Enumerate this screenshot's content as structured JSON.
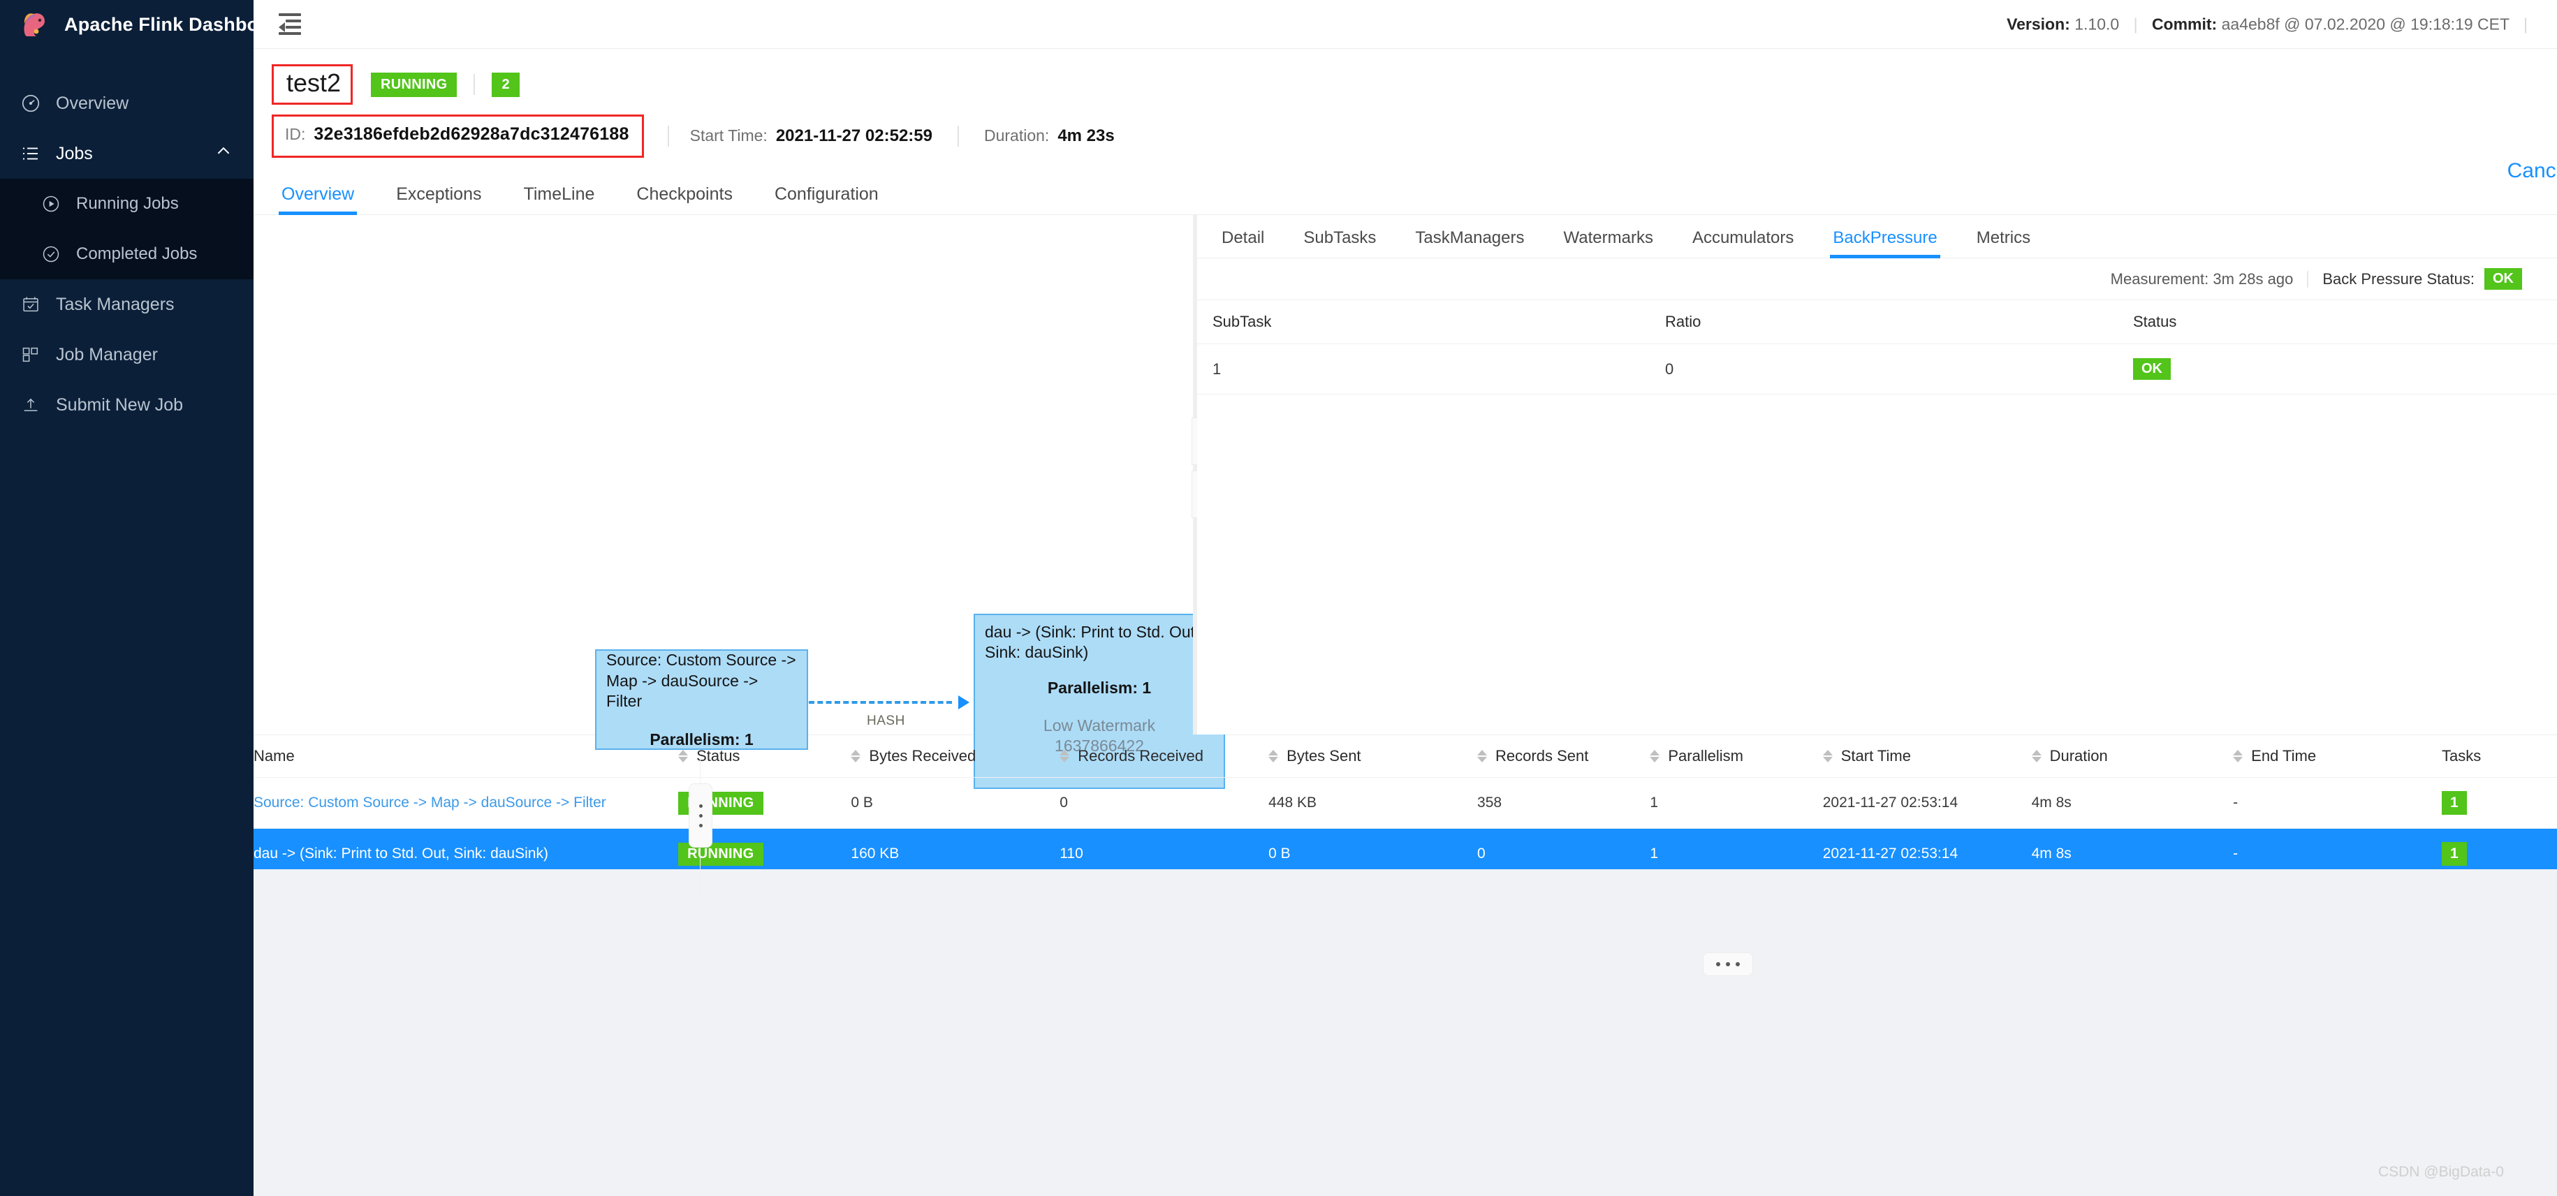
{
  "brand": {
    "title": "Apache Flink Dashboard",
    "logo_icon": "flink-squirrel-logo"
  },
  "sidebar": {
    "items": [
      {
        "label": "Overview",
        "icon": "dashboard-icon",
        "type": "item"
      },
      {
        "label": "Jobs",
        "icon": "list-icon",
        "type": "group",
        "expanded": true,
        "caret": "chevron-up-icon"
      },
      {
        "label": "Running Jobs",
        "icon": "play-circle-icon",
        "type": "sub"
      },
      {
        "label": "Completed Jobs",
        "icon": "check-circle-icon",
        "type": "sub"
      },
      {
        "label": "Task Managers",
        "icon": "calendar-check-icon",
        "type": "item"
      },
      {
        "label": "Job Manager",
        "icon": "cluster-icon",
        "type": "item"
      },
      {
        "label": "Submit New Job",
        "icon": "upload-icon",
        "type": "item"
      }
    ]
  },
  "topbar": {
    "menu_fold_icon": "menu-fold-icon",
    "version_label": "Version:",
    "version_value": "1.10.0",
    "commit_label": "Commit:",
    "commit_value": "aa4eb8f @ 07.02.2020 @ 19:18:19 CET"
  },
  "job": {
    "name": "test2",
    "status": "RUNNING",
    "attempt": "2",
    "id_label": "ID:",
    "id_value": "32e3186efdeb2d62928a7dc312476188",
    "start_time_label": "Start Time:",
    "start_time_value": "2021-11-27 02:52:59",
    "duration_label": "Duration:",
    "duration_value": "4m 23s",
    "cancel_label": "Cancel",
    "tabs": [
      {
        "label": "Overview",
        "active": true
      },
      {
        "label": "Exceptions",
        "active": false
      },
      {
        "label": "TimeLine",
        "active": false
      },
      {
        "label": "Checkpoints",
        "active": false
      },
      {
        "label": "Configuration",
        "active": false
      }
    ]
  },
  "graph": {
    "nodes": [
      {
        "title": "Source: Custom Source -> Map -> dauSource -> Filter",
        "parallelism_label": "Parallelism: 1"
      },
      {
        "title": "dau -> (Sink: Print to Std. Out, Sink: dauSink)",
        "parallelism_label": "Parallelism: 1",
        "watermark_label": "Low Watermark",
        "watermark_value": "1637866422"
      }
    ],
    "edge_label": "HASH",
    "expand_right_icon": "chevron-right-icon",
    "collapse_left_icon": "chevron-left-icon"
  },
  "detail": {
    "tabs": [
      {
        "label": "Detail",
        "active": false
      },
      {
        "label": "SubTasks",
        "active": false
      },
      {
        "label": "TaskManagers",
        "active": false
      },
      {
        "label": "Watermarks",
        "active": false
      },
      {
        "label": "Accumulators",
        "active": false
      },
      {
        "label": "BackPressure",
        "active": true
      },
      {
        "label": "Metrics",
        "active": false
      }
    ],
    "measurement": "Measurement: 3m 28s ago",
    "bp_status_label": "Back Pressure Status:",
    "bp_status_value": "OK",
    "table": {
      "columns": [
        "SubTask",
        "Ratio",
        "Status"
      ],
      "rows": [
        {
          "subtask": "1",
          "ratio": "0",
          "status": "OK"
        }
      ]
    }
  },
  "vertices_table": {
    "columns": [
      {
        "label": "Name",
        "sortable": false
      },
      {
        "label": "Status",
        "sortable": true
      },
      {
        "label": "Bytes Received",
        "sortable": true
      },
      {
        "label": "Records Received",
        "sortable": true
      },
      {
        "label": "Bytes Sent",
        "sortable": true
      },
      {
        "label": "Records Sent",
        "sortable": true
      },
      {
        "label": "Parallelism",
        "sortable": true
      },
      {
        "label": "Start Time",
        "sortable": true
      },
      {
        "label": "Duration",
        "sortable": true
      },
      {
        "label": "End Time",
        "sortable": true
      },
      {
        "label": "Tasks",
        "sortable": false
      }
    ],
    "rows": [
      {
        "name": "Source: Custom Source -> Map -> dauSource -> Filter",
        "status": "RUNNING",
        "bytes_received": "0 B",
        "records_received": "0",
        "bytes_sent": "448 KB",
        "records_sent": "358",
        "parallelism": "1",
        "start_time": "2021-11-27 02:53:14",
        "duration": "4m 8s",
        "end_time": "-",
        "tasks": "1",
        "selected": false
      },
      {
        "name": "dau -> (Sink: Print to Std. Out, Sink: dauSink)",
        "status": "RUNNING",
        "bytes_received": "160 KB",
        "records_received": "110",
        "bytes_sent": "0 B",
        "records_sent": "0",
        "parallelism": "1",
        "start_time": "2021-11-27 02:53:14",
        "duration": "4m 8s",
        "end_time": "-",
        "tasks": "1",
        "selected": true
      }
    ]
  },
  "watermark": "CSDN @BigData-0",
  "colors": {
    "sidebar_bg": "#0b1f38",
    "submenu_bg": "#050f1e",
    "accent": "#1890ff",
    "success": "#52c41a",
    "highlight_box": "#ef2727",
    "node_fill": "#addcf7",
    "node_border": "#59b1ee",
    "row_selected": "#1890ff"
  }
}
